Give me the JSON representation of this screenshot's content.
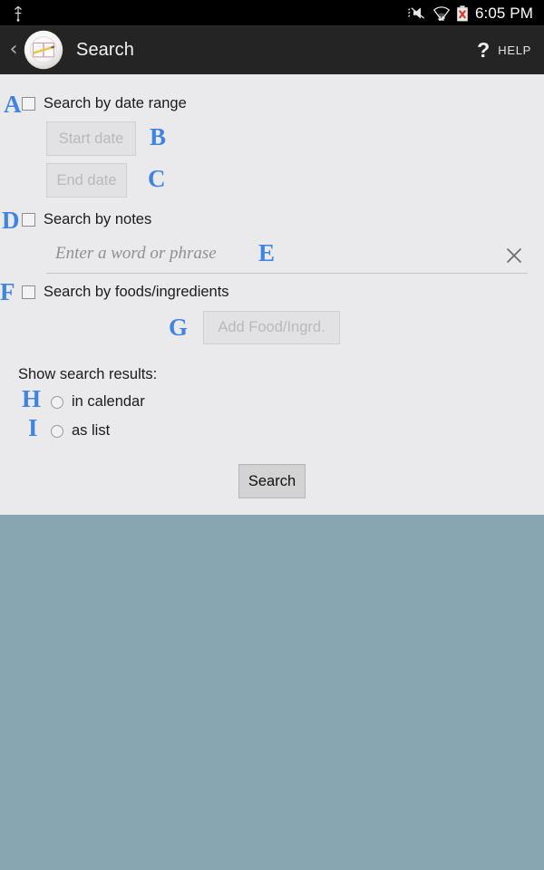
{
  "status_bar": {
    "usb_icon": "usb-icon",
    "mute_icon": "volume-mute-icon",
    "wifi_icon": "wifi-icon",
    "battery_icon": "battery-error-icon",
    "time": "6:05 PM"
  },
  "action_bar": {
    "back_icon": "back-chevron-icon",
    "app_icon": "journal-book-pencil-icon",
    "title": "Search",
    "help_icon": "question-mark-icon",
    "help_label": "HELP"
  },
  "form": {
    "date_range": {
      "annotation": "A",
      "checkbox_label": "Search by date range",
      "checked": false,
      "start_date": {
        "annotation": "B",
        "label": "Start date",
        "enabled": false
      },
      "end_date": {
        "annotation": "C",
        "label": "End date",
        "enabled": false
      }
    },
    "notes": {
      "annotation": "D",
      "checkbox_label": "Search by notes",
      "checked": false,
      "input": {
        "annotation": "E",
        "value": "",
        "placeholder": "Enter a word or phrase",
        "clear_icon": "clear-x-icon"
      }
    },
    "foods": {
      "annotation": "F",
      "checkbox_label": "Search by foods/ingredients",
      "checked": false,
      "add_button": {
        "annotation": "G",
        "label": "Add Food/Ingrd.",
        "enabled": false
      }
    },
    "results_mode": {
      "label": "Show search results:",
      "options": [
        {
          "annotation": "H",
          "label": "in calendar",
          "selected": false
        },
        {
          "annotation": "I",
          "label": "as list",
          "selected": false
        }
      ]
    },
    "submit": {
      "label": "Search",
      "enabled": true
    }
  },
  "colors": {
    "annotation_blue": "#3f85e0",
    "panel_background": "#eaeaec",
    "bottom_background": "#88a6b2",
    "action_bar": "#242424",
    "status_bar": "#000000"
  }
}
